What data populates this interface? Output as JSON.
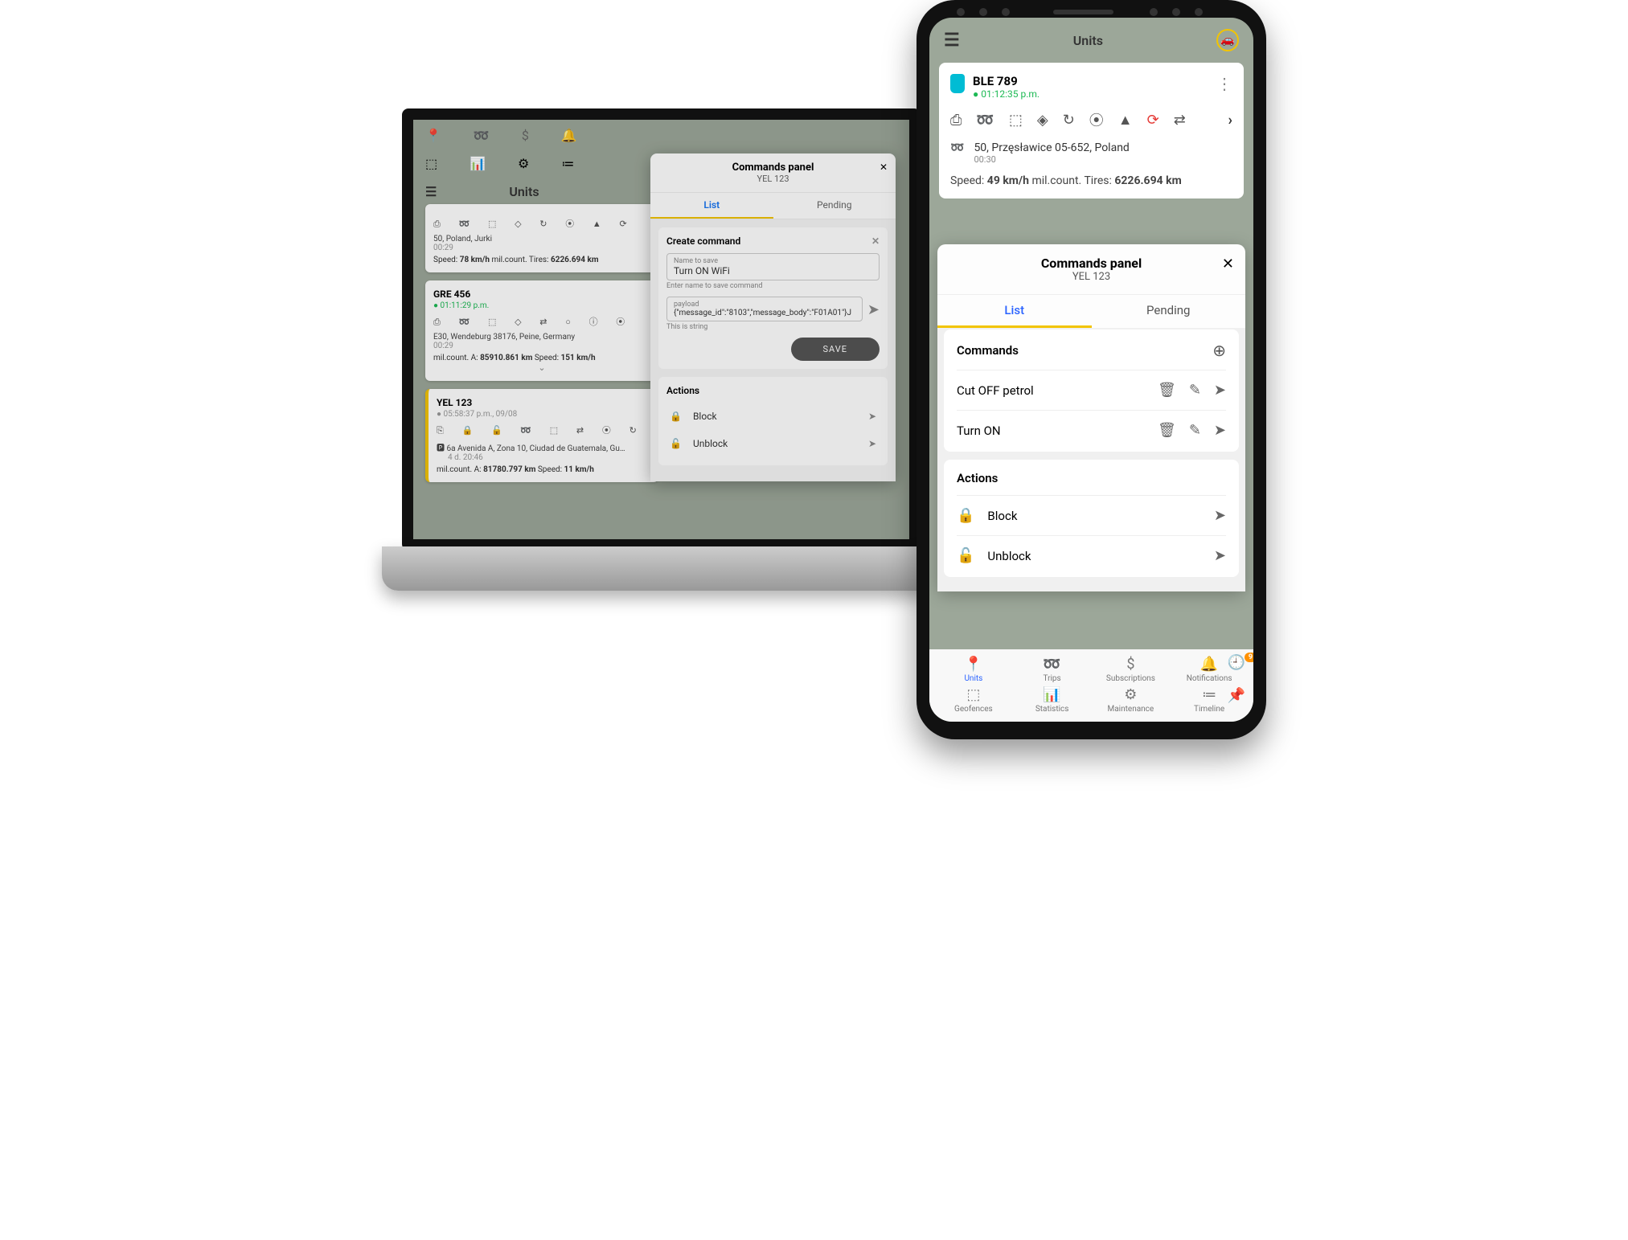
{
  "laptop": {
    "header_title": "Units",
    "units": [
      {
        "name": "",
        "time": "",
        "addr": "50, Poland, Jurki",
        "addr_sub": "00:29",
        "stats_html": "Speed: <b>78 km/h</b>   mil.count. Tires: <b>6226.694 km</b>"
      },
      {
        "name": "GRE 456",
        "time": "● 01:11:29 p.m.",
        "addr": "E30, Wendeburg 38176, Peine, Germany",
        "addr_sub": "00:29",
        "stats_html": "mil.count. A: <b>85910.861 km</b>   Speed: <b>151 km/h</b>"
      },
      {
        "name": "YEL 123",
        "time": "● 05:58:37 p.m., 09/08",
        "addr": "6a Avenida A, Zona 10, Ciudad de Guatemala, Gu…",
        "addr_sub": "4 d. 20:46",
        "stats_html": "mil.count. A: <b>81780.797 km</b>   Speed: <b>11 km/h</b>"
      }
    ],
    "modal": {
      "title": "Commands panel",
      "subtitle": "YEL 123",
      "tab_list": "List",
      "tab_pending": "Pending",
      "create_cmd": "Create command",
      "name_lbl": "Name to save",
      "name_val": "Turn ON WiFi",
      "name_help": "Enter name to save command",
      "payload_lbl": "payload",
      "payload_val": "{\"message_id\":\"8103\",\"message_body\":\"F01A01\"}J",
      "payload_help": "This is string",
      "save": "SAVE",
      "actions": "Actions",
      "block": "Block",
      "unblock": "Unblock"
    }
  },
  "phone": {
    "header": "Units",
    "unit": {
      "name": "BLE 789",
      "time": "● 01:12:35 p.m.",
      "addr": "50, Przęsławice 05-652, Poland",
      "addr_sub": "00:30",
      "stats_html": "Speed: <b>49 km/h</b>   mil.count. Tires: <b>6226.694 km</b>"
    },
    "modal": {
      "title": "Commands panel",
      "subtitle": "YEL 123",
      "tab_list": "List",
      "tab_pending": "Pending",
      "commands_h": "Commands",
      "cmds": [
        "Cut OFF petrol",
        "Turn ON"
      ],
      "actions_h": "Actions",
      "block": "Block",
      "unblock": "Unblock"
    },
    "nav": {
      "units": "Units",
      "trips": "Trips",
      "subs": "Subscriptions",
      "notif": "Notifications",
      "geo": "Geofences",
      "stats": "Statistics",
      "maint": "Maintenance",
      "tl": "Timeline",
      "notif_badge": "9"
    }
  }
}
